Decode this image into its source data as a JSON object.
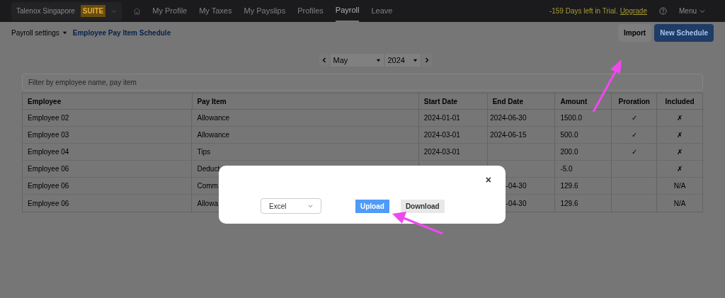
{
  "topbar": {
    "company": "Talenox Singapore",
    "badge": "SUITE",
    "nav": [
      {
        "label": "My Profile",
        "selected": false
      },
      {
        "label": "My Taxes",
        "selected": false
      },
      {
        "label": "My Payslips",
        "selected": false
      },
      {
        "label": "Profiles",
        "selected": false
      },
      {
        "label": "Payroll",
        "selected": true
      },
      {
        "label": "Leave",
        "selected": false
      }
    ],
    "trial": "-159 Days left in Trial.",
    "upgrade": "Upgrade",
    "menu": "Menu"
  },
  "subbar": {
    "settings": "Payroll settings",
    "title": "Employee Pay Item Schedule",
    "buttons": [
      {
        "label": "Import",
        "kind": "secondary"
      },
      {
        "label": "New Schedule",
        "kind": "primary"
      }
    ]
  },
  "period": {
    "month": "May",
    "year": "2024"
  },
  "filter": {
    "placeholder": "Filter by employee name, pay item"
  },
  "table": {
    "columns": [
      "Employee",
      "Pay Item",
      "Start Date",
      "End Date",
      "Amount",
      "Proration",
      "Included"
    ],
    "rows": [
      {
        "cells": [
          "Employee 02",
          "Allowance",
          "2024-01-01",
          "2024-06-30",
          "1500.0",
          "✓",
          "✗"
        ]
      },
      {
        "cells": [
          "Employee 03",
          "Allowance",
          "2024-03-01",
          "2024-06-15",
          "500.0",
          "✓",
          "✗"
        ]
      },
      {
        "cells": [
          "Employee 04",
          "Tips",
          "2024-03-01",
          "",
          "200.0",
          "✓",
          "✗"
        ]
      },
      {
        "cells": [
          "Employee 06",
          "Deduct",
          "",
          "",
          "-5.0",
          "",
          "✗"
        ]
      },
      {
        "cells": [
          "Employee 06",
          "Comm",
          "",
          "-04-30",
          "129.6",
          "",
          "N/A"
        ]
      },
      {
        "cells": [
          "Employee 06",
          "Allowa",
          "",
          "-04-30",
          "129.6",
          "",
          "N/A"
        ]
      }
    ]
  },
  "dialog": {
    "close": "×",
    "format": "Excel",
    "buttons": [
      {
        "label": "Upload",
        "kind": "primary"
      },
      {
        "label": "Download",
        "kind": "secondary"
      }
    ]
  }
}
